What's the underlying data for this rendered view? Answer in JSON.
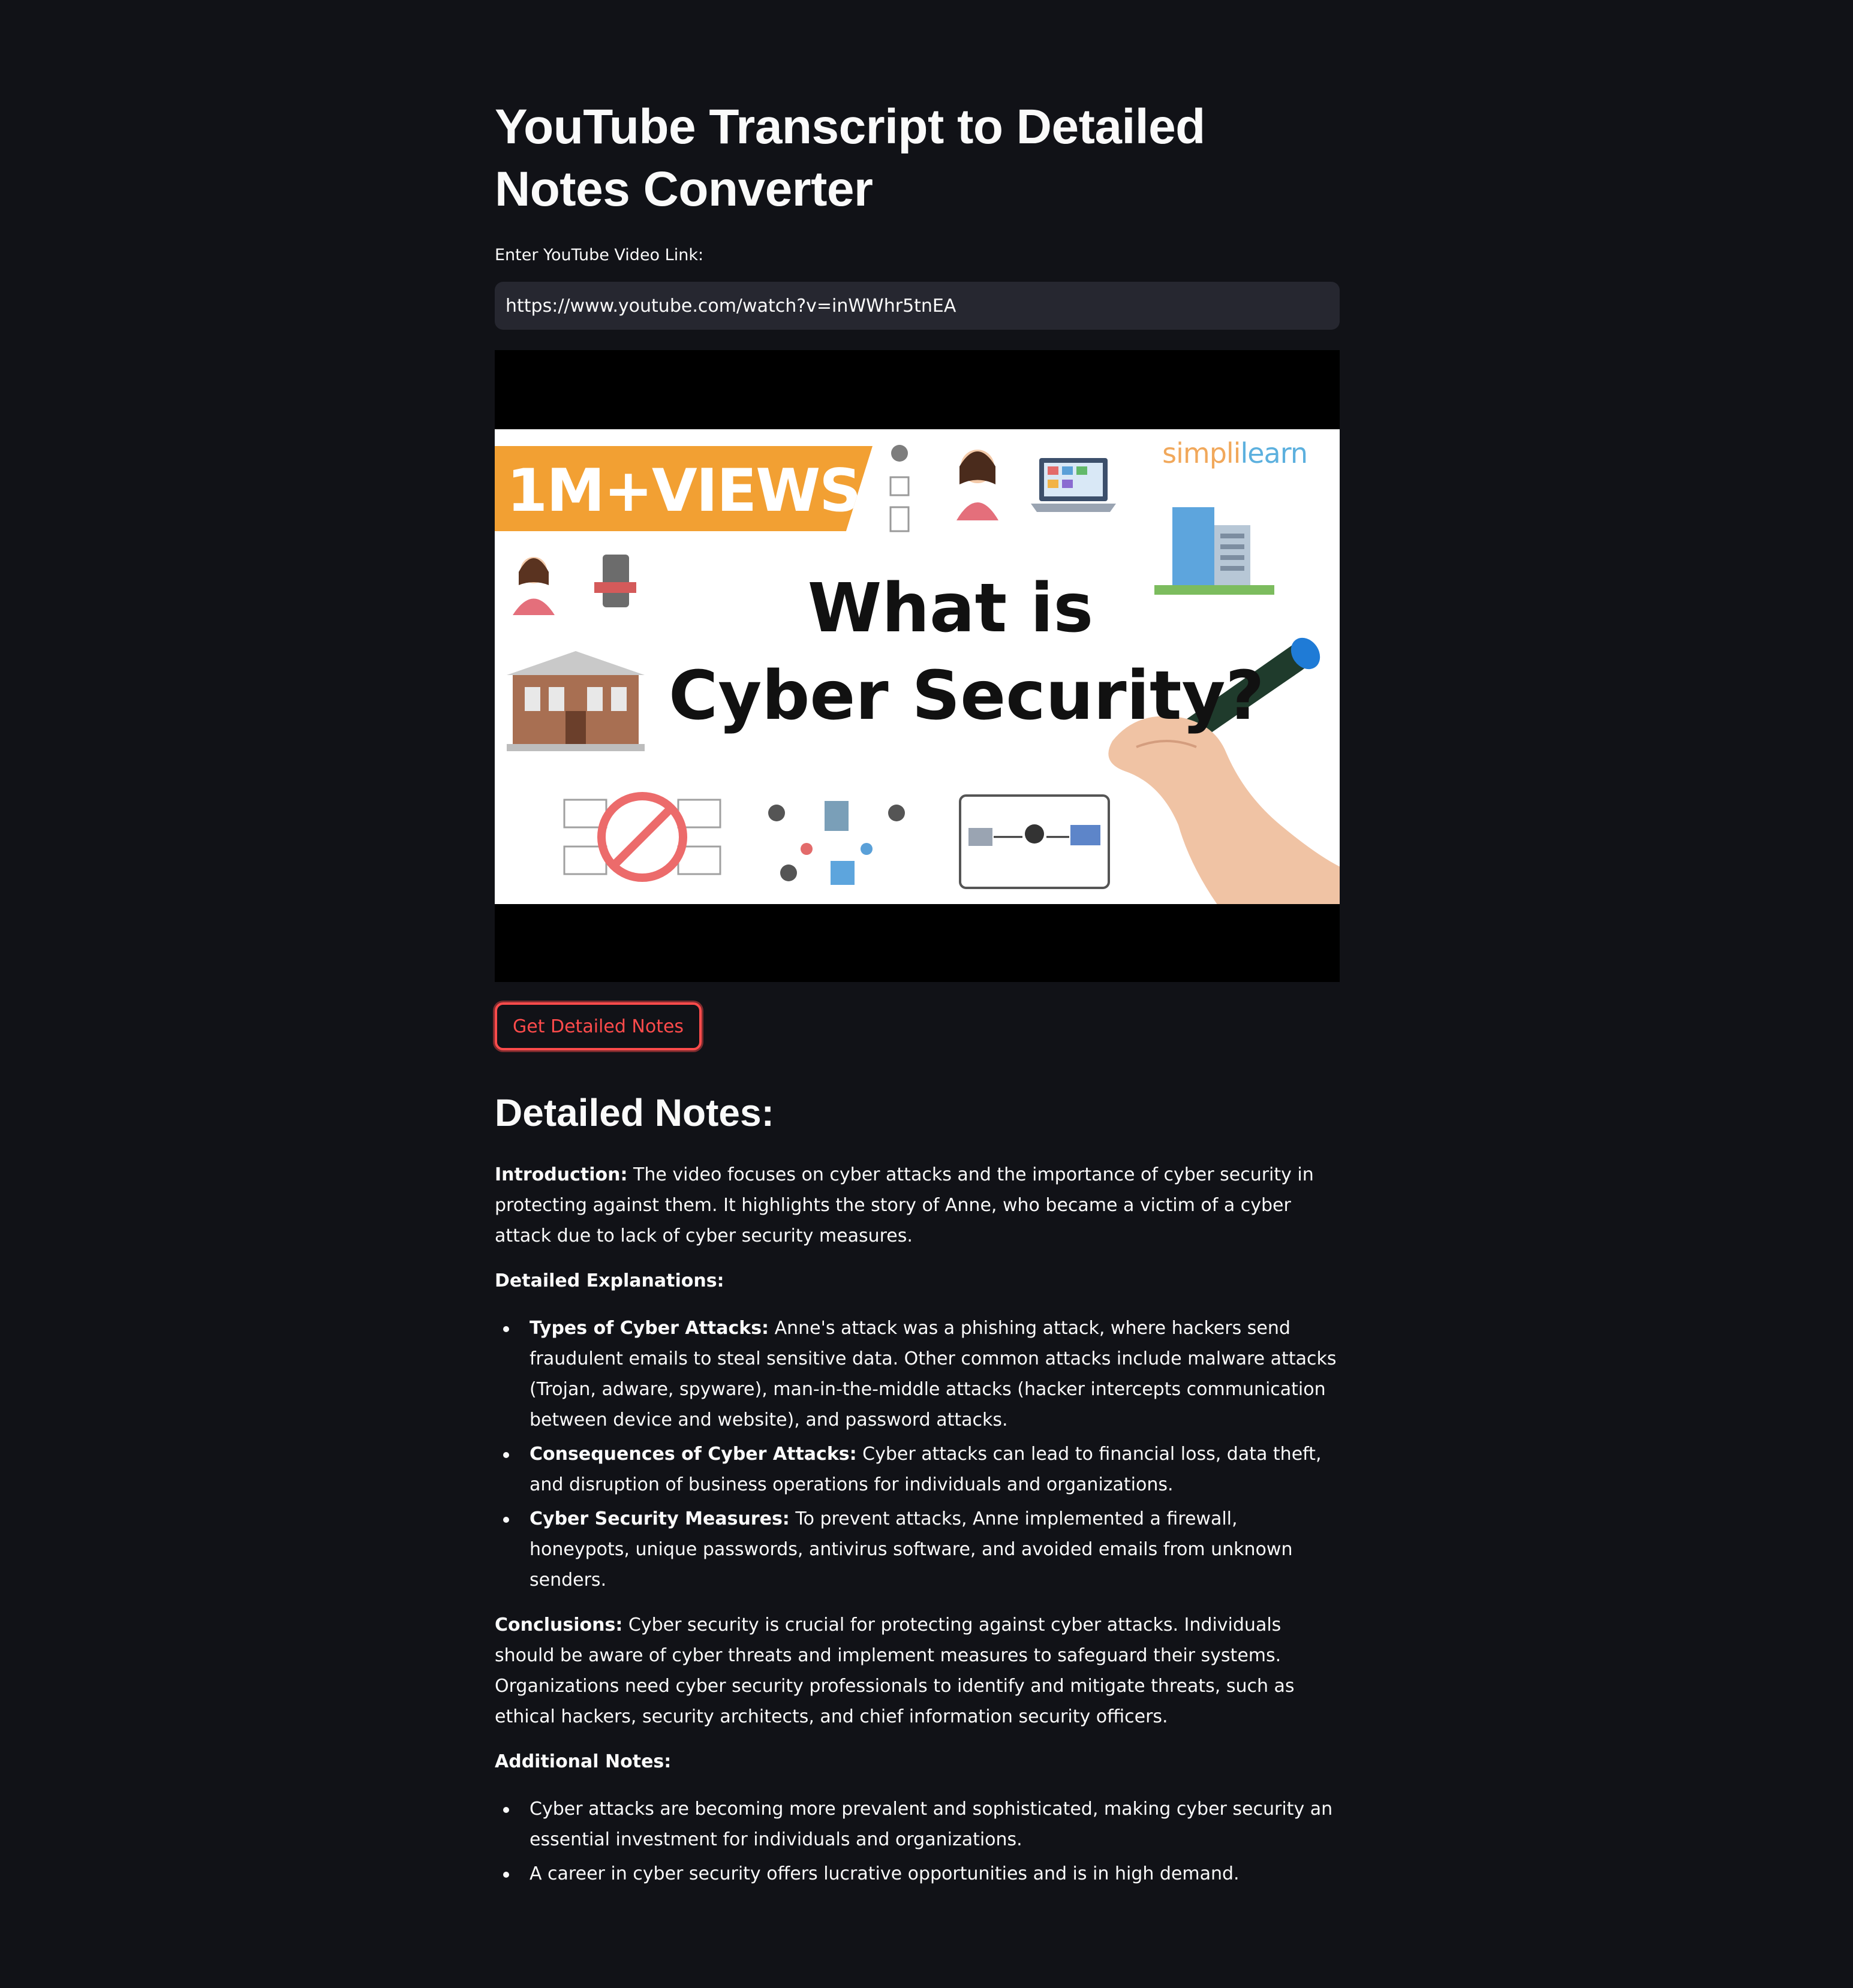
{
  "page": {
    "title": "YouTube Transcript to Detailed Notes Converter"
  },
  "input": {
    "label": "Enter YouTube Video Link:",
    "value": "https://www.youtube.com/watch?v=inWWhr5tnEA"
  },
  "video": {
    "banner_text": "1M+VIEWS",
    "title_line1": "What is",
    "title_line2": "Cyber Security?",
    "brand_part1": "simpli",
    "brand_part2": "learn"
  },
  "button": {
    "label": "Get Detailed Notes"
  },
  "notes": {
    "heading": "Detailed Notes:",
    "intro": {
      "label": "Introduction:",
      "text": " The video focuses on cyber attacks and the importance of cyber security in protecting against them. It highlights the story of Anne, who became a victim of a cyber attack due to lack of cyber security measures."
    },
    "explanations_heading": "Detailed Explanations:",
    "explanations": [
      {
        "label": "Types of Cyber Attacks:",
        "text": " Anne's attack was a phishing attack, where hackers send fraudulent emails to steal sensitive data. Other common attacks include malware attacks (Trojan, adware, spyware), man-in-the-middle attacks (hacker intercepts communication between device and website), and password attacks."
      },
      {
        "label": "Consequences of Cyber Attacks:",
        "text": " Cyber attacks can lead to financial loss, data theft, and disruption of business operations for individuals and organizations."
      },
      {
        "label": "Cyber Security Measures:",
        "text": " To prevent attacks, Anne implemented a firewall, honeypots, unique passwords, antivirus software, and avoided emails from unknown senders."
      }
    ],
    "conclusions": {
      "label": "Conclusions:",
      "text": " Cyber security is crucial for protecting against cyber attacks. Individuals should be aware of cyber threats and implement measures to safeguard their systems. Organizations need cyber security professionals to identify and mitigate threats, such as ethical hackers, security architects, and chief information security officers."
    },
    "additional_heading": "Additional Notes:",
    "additional": [
      "Cyber attacks are becoming more prevalent and sophisticated, making cyber security an essential investment for individuals and organizations.",
      "A career in cyber security offers lucrative opportunities and is in high demand."
    ]
  },
  "colors": {
    "background": "#111217",
    "input_bg": "#262730",
    "accent": "#ff4b4b",
    "banner": "#f2a033"
  }
}
